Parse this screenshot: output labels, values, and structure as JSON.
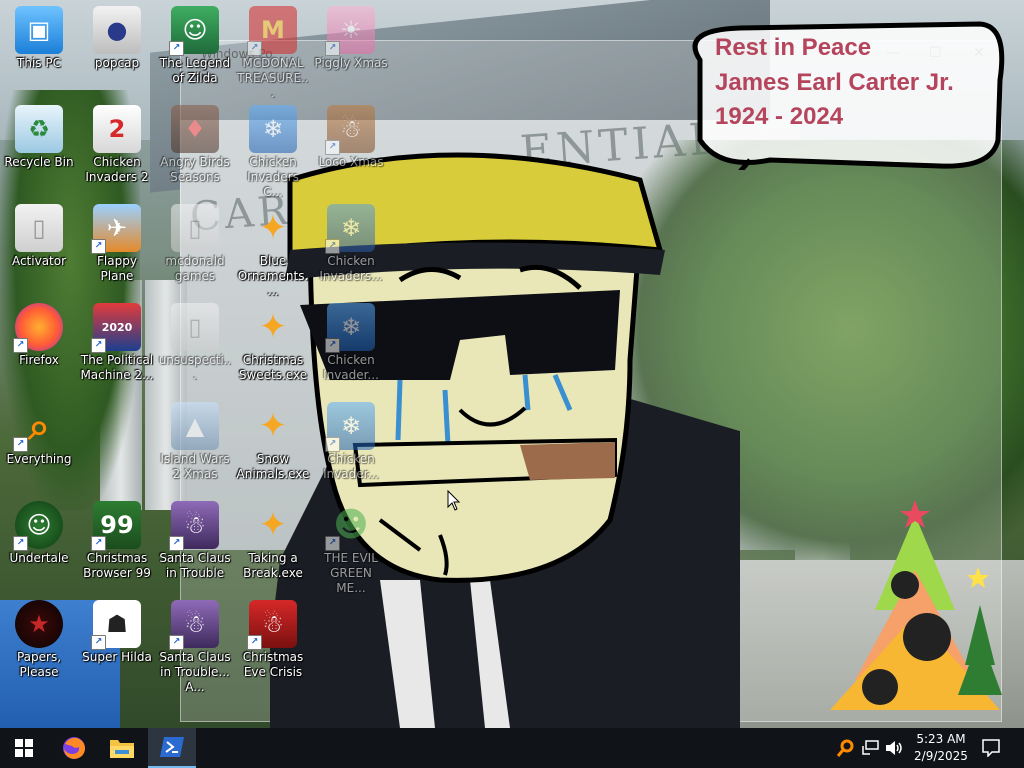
{
  "desktop": {
    "icons": [
      {
        "label": "This PC",
        "icon": "this-pc-icon",
        "shortcut": false
      },
      {
        "label": "popcap",
        "icon": "popcap-icon",
        "shortcut": false
      },
      {
        "label": "The Legend of Zilda",
        "icon": "legend-of-zilda-icon",
        "shortcut": true
      },
      {
        "label": "MCDONAL TREASURE...",
        "icon": "mcdonalds-icon",
        "shortcut": true
      },
      {
        "label": "Piggly Xmas",
        "icon": "piggly-xmas-icon",
        "shortcut": true
      },
      {
        "label": "Recycle Bin",
        "icon": "recycle-bin-icon",
        "shortcut": false
      },
      {
        "label": "Chicken Invaders 2",
        "icon": "chicken-invaders-2-icon",
        "shortcut": false
      },
      {
        "label": "Angry Birds Seasons",
        "icon": "angry-birds-icon",
        "shortcut": false
      },
      {
        "label": "Chicken Invaders C...",
        "icon": "chicken-invaders-icon",
        "shortcut": false
      },
      {
        "label": "Loco Xmas",
        "icon": "loco-xmas-icon",
        "shortcut": true
      },
      {
        "label": "Activator",
        "icon": "folder-icon",
        "shortcut": false
      },
      {
        "label": "Flappy Plane",
        "icon": "flappy-plane-icon",
        "shortcut": true
      },
      {
        "label": "mcdonald games",
        "icon": "folder-icon",
        "shortcut": false
      },
      {
        "label": "Blue Ornaments....",
        "icon": "puzzle-exe-icon",
        "shortcut": false
      },
      {
        "label": "Chicken Invaders...",
        "icon": "chicken-invaders-xmas-icon",
        "shortcut": true
      },
      {
        "label": "Firefox",
        "icon": "firefox-icon",
        "shortcut": true
      },
      {
        "label": "The Political Machine 2...",
        "icon": "political-machine-icon",
        "shortcut": true
      },
      {
        "label": "unsuspecti...",
        "icon": "folder-icon",
        "shortcut": false
      },
      {
        "label": "Christmas Sweets.exe",
        "icon": "puzzle-exe-icon",
        "shortcut": false
      },
      {
        "label": "Chicken Invader...",
        "icon": "chicken-invaders-icon",
        "shortcut": true
      },
      {
        "label": "Everything",
        "icon": "everything-search-icon",
        "shortcut": true
      },
      {
        "label": "Island Wars 2 Xmas",
        "icon": "island-wars-icon",
        "shortcut": false
      },
      {
        "label": "Snow Animals.exe",
        "icon": "puzzle-exe-icon",
        "shortcut": false
      },
      {
        "label": "Chicken Invader...",
        "icon": "chicken-invaders-icon",
        "shortcut": true
      },
      {
        "label": "Undertale",
        "icon": "undertale-icon",
        "shortcut": true
      },
      {
        "label": "Christmas Browser 99",
        "icon": "christmas-browser-icon",
        "shortcut": true
      },
      {
        "label": "Santa Claus in Trouble",
        "icon": "santa-claus-icon",
        "shortcut": true
      },
      {
        "label": "Taking a Break.exe",
        "icon": "puzzle-exe-icon",
        "shortcut": false
      },
      {
        "label": "THE EVIL GREEN ME...",
        "icon": "msn-messenger-icon",
        "shortcut": true
      },
      {
        "label": "Papers, Please",
        "icon": "papers-please-icon",
        "shortcut": false
      },
      {
        "label": "Super Hilda",
        "icon": "super-hilda-icon",
        "shortcut": true
      },
      {
        "label": "Santa Claus in Trouble... A...",
        "icon": "santa-claus-icon",
        "shortcut": true
      },
      {
        "label": "Christmas Eve Crisis",
        "icon": "santa-face-icon",
        "shortcut": true
      }
    ]
  },
  "wallpaper": {
    "speech_line1": "Rest in Peace",
    "speech_line2": "James Earl Carter Jr.",
    "speech_line3": "1924 - 2024",
    "building_sign": "ENTIAL",
    "building_sign2": "CART"
  },
  "ghost_window": {
    "title": "Windows Po"
  },
  "taskbar": {
    "start": "start-icon",
    "pinned": [
      {
        "name": "firefox-taskbar",
        "icon": "firefox-icon"
      },
      {
        "name": "file-explorer-taskbar",
        "icon": "folder-icon"
      },
      {
        "name": "powershell-taskbar",
        "icon": "powershell-icon",
        "active": true
      }
    ],
    "time": "5:23 AM",
    "date": "2/9/2025"
  },
  "colors": {
    "taskbar": "#101418",
    "speech_text": "#b5455c",
    "cartoon_hat": "#d9cc3a",
    "cartoon_face": "#e9e7b7"
  }
}
